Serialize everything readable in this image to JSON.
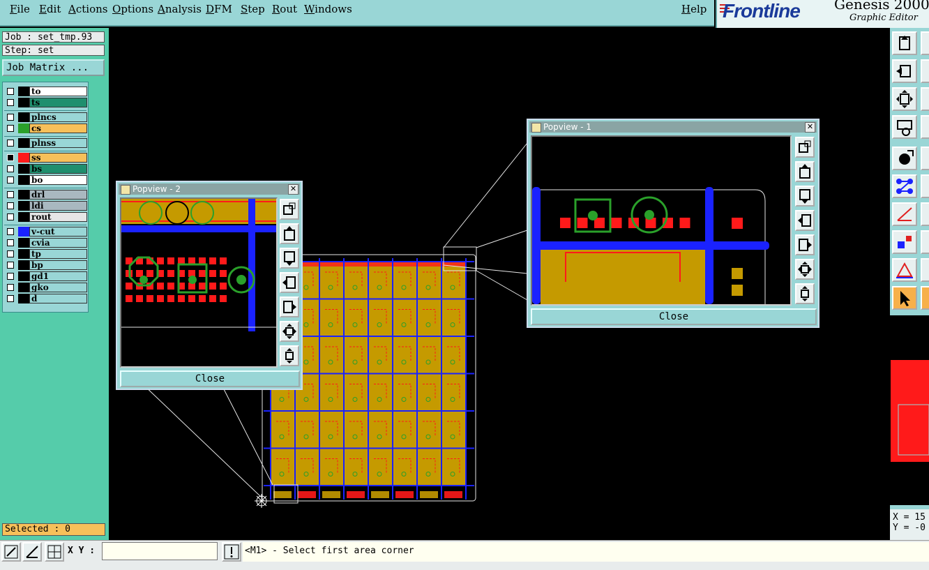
{
  "menubar": {
    "items": [
      "File",
      "Edit",
      "Actions",
      "Options",
      "Analysis",
      "DFM",
      "Step",
      "Rout",
      "Windows"
    ],
    "help": "Help"
  },
  "brand": {
    "logo": "Frontline",
    "title": "Genesis 2000",
    "subtitle": "Graphic Editor"
  },
  "job": {
    "job_label": "Job : set_tmp.93",
    "step_label": "Step: set",
    "matrix_button": "Job Matrix ..."
  },
  "layers": [
    {
      "name": "to",
      "color": "#ffffff",
      "swatch": "#000000"
    },
    {
      "name": "ts",
      "color": "#1f8f6e",
      "swatch": "#000000"
    },
    {
      "name": "plncs",
      "color": "#99d6d6",
      "swatch": "#000000"
    },
    {
      "name": "cs",
      "color": "#f7c05a",
      "swatch": "#2aa02a"
    },
    {
      "name": "plnss",
      "color": "#99d6d6",
      "swatch": "#000000"
    },
    {
      "name": "ss",
      "color": "#f7c05a",
      "swatch": "#ff1a1a",
      "active": true
    },
    {
      "name": "bs",
      "color": "#1f8f6e",
      "swatch": "#000000"
    },
    {
      "name": "bo",
      "color": "#ffffff",
      "swatch": "#000000"
    },
    {
      "name": "drl",
      "color": "#a9b8c0",
      "swatch": "#000000"
    },
    {
      "name": "ldi",
      "color": "#a9b8c0",
      "swatch": "#000000"
    },
    {
      "name": "rout",
      "color": "#e6e6e6",
      "swatch": "#000000"
    },
    {
      "name": "v-cut",
      "color": "#99d6d6",
      "swatch": "#1a22ff"
    },
    {
      "name": "cvia",
      "color": "#99d6d6",
      "swatch": "#000000"
    },
    {
      "name": "tp",
      "color": "#99d6d6",
      "swatch": "#000000"
    },
    {
      "name": "bp",
      "color": "#99d6d6",
      "swatch": "#000000"
    },
    {
      "name": "gd1",
      "color": "#99d6d6",
      "swatch": "#000000"
    },
    {
      "name": "gko",
      "color": "#99d6d6",
      "swatch": "#000000"
    },
    {
      "name": "d",
      "color": "#99d6d6",
      "swatch": "#000000"
    }
  ],
  "status": {
    "selected": "Selected : 0",
    "xy_label": "X Y :",
    "xy_value": "",
    "prompt": "<M1> - Select first area corner"
  },
  "coords": {
    "x_label": "X = 15",
    "y_label": "Y = -0"
  },
  "popview1": {
    "title": "Popview - 1",
    "close_label": "Close"
  },
  "popview2": {
    "title": "Popview - 2",
    "close_label": "Close"
  },
  "colors": {
    "panel": "#99d6d6",
    "leftpanel": "#55ccaa",
    "copper": "#c59a00",
    "vcut": "#1a22ff",
    "pad": "#ff1a1a",
    "ring": "#2aa02a"
  }
}
